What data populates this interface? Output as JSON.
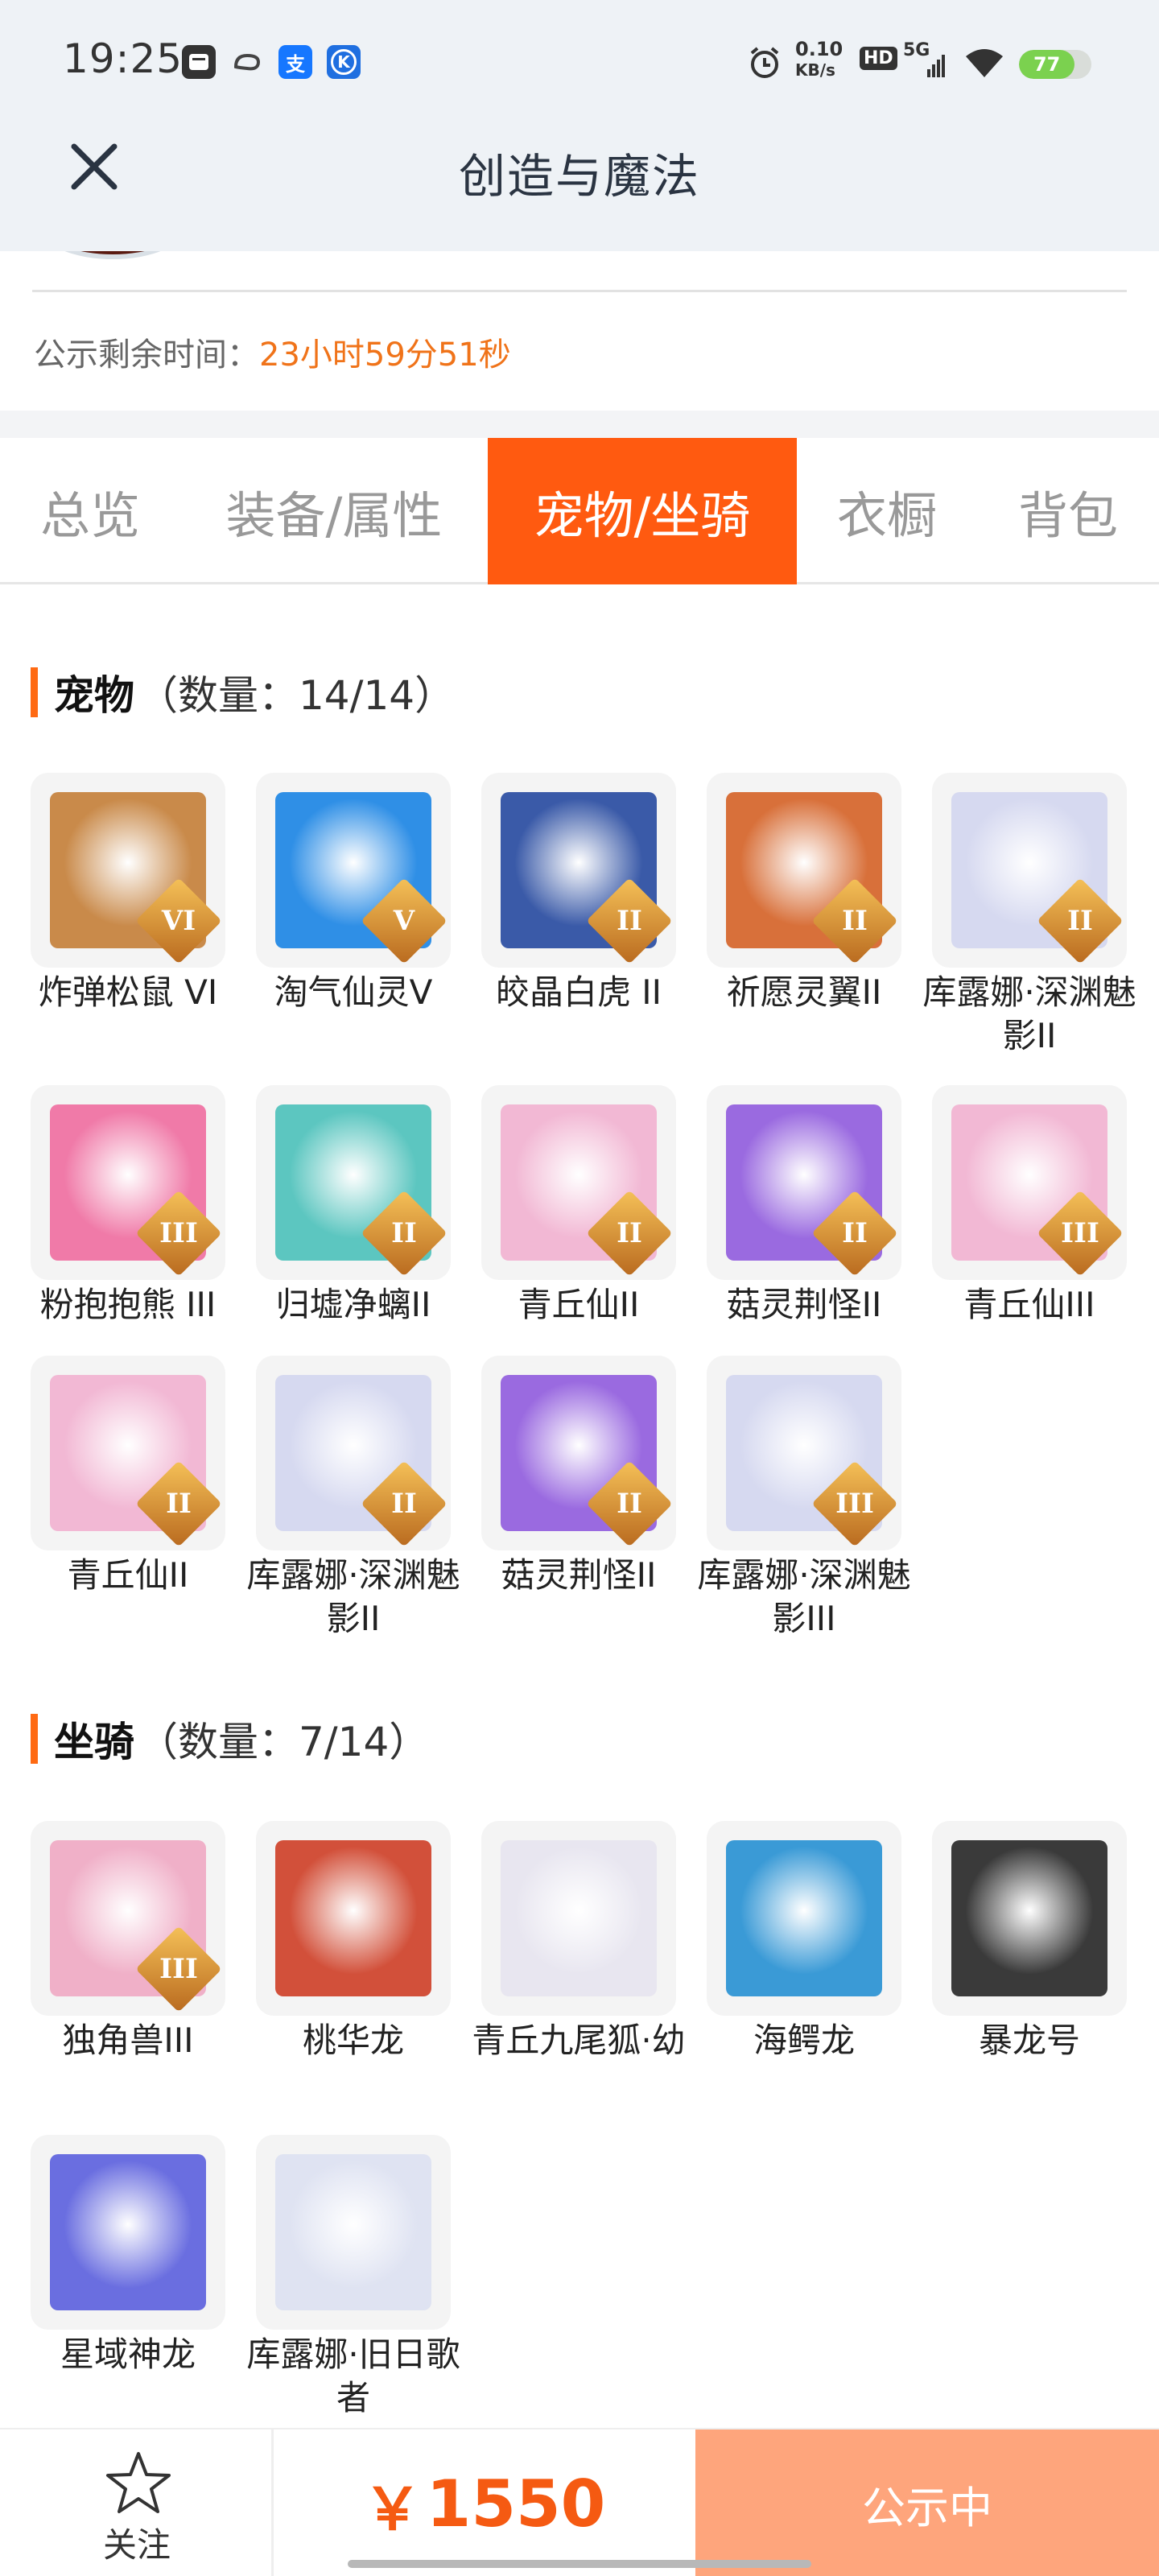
{
  "status_bar": {
    "time": "19:25",
    "net_speed_top": "0.10",
    "net_speed_unit": "KB/s",
    "hd": "HD",
    "signal": "5G",
    "battery": "77",
    "battery_level": 0.77,
    "app_icons": [
      "message-icon",
      "cloud-icon",
      "alipay-icon",
      "k-app-icon"
    ],
    "alipay_glyph": "支",
    "k_glyph": "K"
  },
  "header": {
    "title": "创造与魔法",
    "close_icon": "close-icon"
  },
  "notice": {
    "label": "公示剩余时间：",
    "value": "23小时59分51秒"
  },
  "tabs": [
    {
      "label": "总览",
      "active": false
    },
    {
      "label": "装备/属性",
      "active": false
    },
    {
      "label": "宠物/坐骑",
      "active": true
    },
    {
      "label": "衣橱",
      "active": false
    },
    {
      "label": "背包",
      "active": false
    }
  ],
  "pets": {
    "title": "宠物",
    "count": "（数量：14/14）",
    "items": [
      {
        "name": "炸弹松鼠 VI",
        "badge": "VI",
        "color": "#c98a4a"
      },
      {
        "name": "淘气仙灵V",
        "badge": "V",
        "color": "#2f8fe6"
      },
      {
        "name": "皎晶白虎 II",
        "badge": "II",
        "color": "#3a5aa8"
      },
      {
        "name": "祈愿灵翼II",
        "badge": "II",
        "color": "#d8703a"
      },
      {
        "name": "库露娜·深渊魅影II",
        "badge": "II",
        "color": "#d6d9f0"
      },
      {
        "name": "粉抱抱熊 III",
        "badge": "III",
        "color": "#f07aa8"
      },
      {
        "name": "归墟净螭II",
        "badge": "II",
        "color": "#5cc6c0"
      },
      {
        "name": "青丘仙II",
        "badge": "II",
        "color": "#f2b8d4"
      },
      {
        "name": "菇灵荆怪II",
        "badge": "II",
        "color": "#9a6ae0"
      },
      {
        "name": "青丘仙III",
        "badge": "III",
        "color": "#f2b8d4"
      },
      {
        "name": "青丘仙II",
        "badge": "II",
        "color": "#f2b8d4"
      },
      {
        "name": "库露娜·深渊魅影II",
        "badge": "II",
        "color": "#d6d9f0"
      },
      {
        "name": "菇灵荆怪II",
        "badge": "II",
        "color": "#9a6ae0"
      },
      {
        "name": "库露娜·深渊魅影III",
        "badge": "III",
        "color": "#d6d9f0"
      }
    ]
  },
  "mounts": {
    "title": "坐骑",
    "count": "（数量：7/14）",
    "items": [
      {
        "name": "独角兽III",
        "badge": "III",
        "color": "#f0b0c8"
      },
      {
        "name": "桃华龙",
        "badge": "",
        "color": "#d2503a"
      },
      {
        "name": "青丘九尾狐·幼",
        "badge": "",
        "color": "#e8e6f0"
      },
      {
        "name": "海鳄龙",
        "badge": "",
        "color": "#3a9ad6"
      },
      {
        "name": "暴龙号",
        "badge": "",
        "color": "#3a3a3a"
      },
      {
        "name": "星域神龙",
        "badge": "",
        "color": "#6a6ee0"
      },
      {
        "name": "库露娜·旧日歌者",
        "badge": "",
        "color": "#dfe3f2"
      }
    ]
  },
  "bottom": {
    "follow_label": "关注",
    "star_icon": "star-icon",
    "currency": "￥",
    "price": "1550",
    "status_button": "公示中"
  },
  "colors": {
    "accent": "#ff5a10",
    "price": "#f55a12",
    "status_button_bg": "#fea57c",
    "notice_value": "#f07319"
  }
}
